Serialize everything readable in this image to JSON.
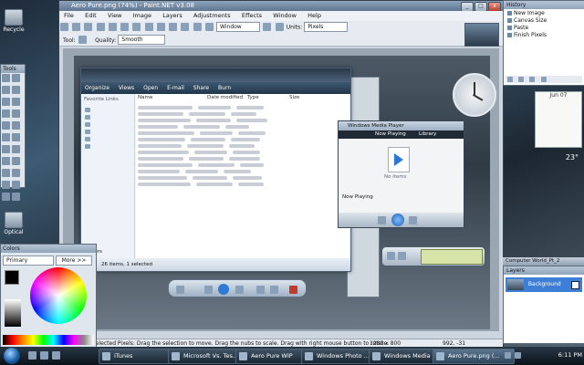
{
  "paintnet": {
    "title": "Aero Pure.png (74%) - Paint.NET v3.08",
    "menu": [
      "File",
      "Edit",
      "View",
      "Image",
      "Layers",
      "Adjustments",
      "Effects",
      "Window",
      "Help"
    ],
    "window_zoom": "Window",
    "units_label": "Units:",
    "units_value": "Pixels",
    "tool_label": "Tool:",
    "quality_label": "Quality:",
    "quality_value": "Smooth",
    "status": "Selected Pixels: Drag the selection to move. Drag the nubs to scale. Drag with right mouse button to rotate.",
    "image_size": "1280 x 800",
    "cursor": "992, -31"
  },
  "history": {
    "title": "History",
    "items": [
      "New Image",
      "Canvas Size",
      "Paste",
      "Finish Pixels"
    ]
  },
  "layers": {
    "title": "Layers",
    "items": [
      "Background"
    ]
  },
  "tools": {
    "title": "Tools"
  },
  "colors": {
    "title": "Colors",
    "select_value": "Primary",
    "more_button": "More >>"
  },
  "explorer": {
    "cmd": [
      "Organize",
      "Views",
      "Open",
      "E-mail",
      "Share",
      "Burn"
    ],
    "columns": [
      "Name",
      "Date modified",
      "Type",
      "Size"
    ],
    "nav_title": "Favorite Links",
    "status": "26 items, 1 selected",
    "folders_label": "Folders"
  },
  "wmp": {
    "title": "Windows Media Player",
    "tabs": [
      "Now Playing",
      "Library"
    ],
    "no_items": "No items",
    "now_playing": "Now Playing"
  },
  "background_window": {
    "title": "Computer World_Pt_2"
  },
  "desktop_icons": [
    "Recycle",
    "Optical"
  ],
  "taskbar": {
    "buttons": [
      "iTunes",
      "Microsoft Vs. Tes...",
      "Aero Pure WIP",
      "Windows Photo ...",
      "Windows Media ...",
      "Aero Pure.png (..."
    ],
    "clock": "6:11 PM"
  },
  "gadgets": {
    "weather_temp": "23°",
    "calendar_month": "Jun 07"
  }
}
